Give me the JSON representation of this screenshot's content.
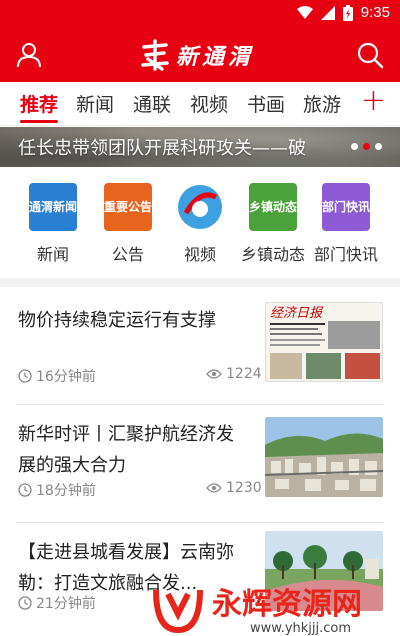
{
  "status_bar": {
    "time": "9:35",
    "icons": [
      "wifi-icon",
      "signal-icon",
      "battery-icon"
    ]
  },
  "header": {
    "logo_text": "新通渭"
  },
  "tabs": [
    {
      "label": "推荐",
      "active": true
    },
    {
      "label": "新闻",
      "active": false
    },
    {
      "label": "通联",
      "active": false
    },
    {
      "label": "视频",
      "active": false
    },
    {
      "label": "书画",
      "active": false
    },
    {
      "label": "旅游",
      "active": false
    }
  ],
  "tab_add": "+",
  "banner": {
    "title": "任长忠带领团队开展科研攻关——破",
    "dots": 3,
    "active_dot": 1
  },
  "categories": [
    {
      "label": "新闻",
      "icon_text": "通渭新闻",
      "color": "#2a7fd4"
    },
    {
      "label": "公告",
      "icon_text": "重要公告",
      "color": "#e8641e"
    },
    {
      "label": "视频",
      "icon_text": "",
      "color": "#3da0e0"
    },
    {
      "label": "乡镇动态",
      "icon_text": "乡镇动态",
      "color": "#4aa33a"
    },
    {
      "label": "部门快讯",
      "icon_text": "部门快讯",
      "color": "#8e5bd4"
    }
  ],
  "news": [
    {
      "title": "物价持续稳定运行有支撑",
      "time": "16分钟前",
      "views": "1224",
      "thumb": "newspaper",
      "paper_name": "经济日报"
    },
    {
      "title": "新华时评丨汇聚护航经济发展的强大合力",
      "time": "18分钟前",
      "views": "1230",
      "thumb": "town"
    },
    {
      "title": "【走进县城看发展】云南弥勒：打造文旅融合发...",
      "time": "21分钟前",
      "views": "",
      "thumb": "park"
    }
  ],
  "watermark": {
    "text": "永辉资源网",
    "url": "www.yhkjjj.com"
  },
  "colors": {
    "brand": "#e60012",
    "muted": "#888888"
  }
}
